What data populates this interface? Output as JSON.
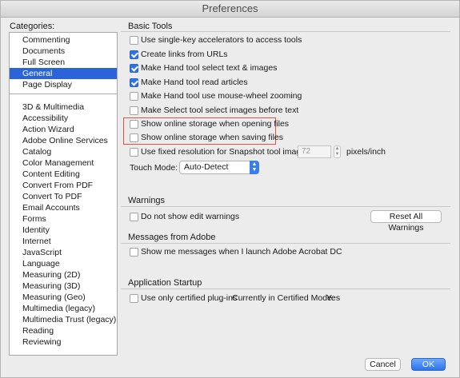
{
  "window": {
    "title": "Preferences"
  },
  "categories": {
    "label": "Categories:",
    "top_items": [
      "Commenting",
      "Documents",
      "Full Screen",
      "General",
      "Page Display"
    ],
    "selected": "General",
    "other_items": [
      "3D & Multimedia",
      "Accessibility",
      "Action Wizard",
      "Adobe Online Services",
      "Catalog",
      "Color Management",
      "Content Editing",
      "Convert From PDF",
      "Convert To PDF",
      "Email Accounts",
      "Forms",
      "Identity",
      "Internet",
      "JavaScript",
      "Language",
      "Measuring (2D)",
      "Measuring (3D)",
      "Measuring (Geo)",
      "Multimedia (legacy)",
      "Multimedia Trust (legacy)",
      "Reading",
      "Reviewing"
    ]
  },
  "basic_tools": {
    "title": "Basic Tools",
    "options": [
      {
        "label": "Use single-key accelerators to access tools",
        "checked": false
      },
      {
        "label": "Create links from URLs",
        "checked": true
      },
      {
        "label": "Make Hand tool select text & images",
        "checked": true
      },
      {
        "label": "Make Hand tool read articles",
        "checked": true
      },
      {
        "label": "Make Hand tool use mouse-wheel zooming",
        "checked": false
      },
      {
        "label": "Make Select tool select images before text",
        "checked": false
      },
      {
        "label": "Show online storage when opening files",
        "checked": false
      },
      {
        "label": "Show online storage when saving files",
        "checked": false
      }
    ],
    "snapshot": {
      "label": "Use fixed resolution for Snapshot tool images:",
      "checked": false,
      "value": "72",
      "units": "pixels/inch"
    },
    "touch_mode": {
      "label": "Touch Mode:",
      "value": "Auto-Detect"
    }
  },
  "warnings": {
    "title": "Warnings",
    "option_label": "Do not show edit warnings",
    "checked": false,
    "reset_button": "Reset All Warnings"
  },
  "messages": {
    "title": "Messages from Adobe",
    "option_label": "Show me messages when I launch Adobe Acrobat DC",
    "checked": false
  },
  "startup": {
    "title": "Application Startup",
    "option_label": "Use only certified plug-ins",
    "checked": false,
    "mode_label": "Currently in Certified Mode:",
    "mode_value": "Yes"
  },
  "footer": {
    "cancel": "Cancel",
    "ok": "OK"
  },
  "colors": {
    "accent": "#2b63d9",
    "highlight": "#e0533d"
  }
}
